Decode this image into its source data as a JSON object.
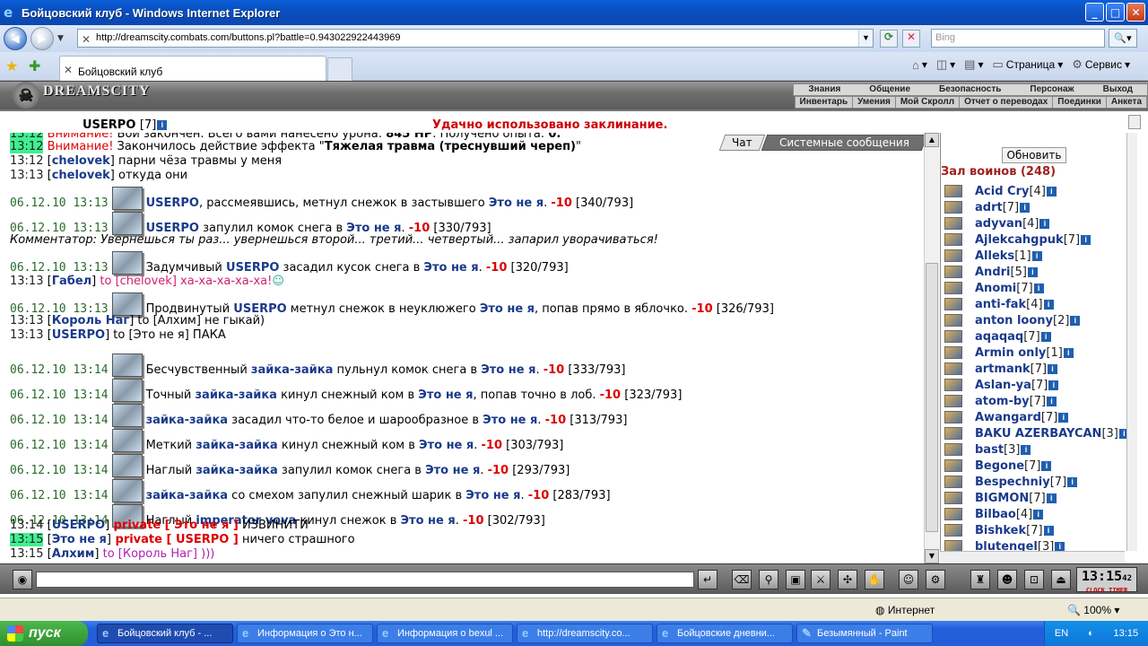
{
  "window": {
    "title": "Бойцовский клуб - Windows Internet Explorer"
  },
  "browser": {
    "url": "http://dreamscity.combats.com/buttons.pl?battle=0.943022922443969",
    "search_placeholder": "Bing",
    "tab_title": "Бойцовский клуб",
    "cmd_page": "Страница",
    "cmd_service": "Сервис"
  },
  "game": {
    "logo": "DREAMSCITY",
    "menu_top": [
      "Знания",
      "Общение",
      "Безопасность",
      "Персонаж",
      "Выход"
    ],
    "menu_bottom": [
      "Инвентарь",
      "Умения",
      "Мой Скролл",
      "Отчет о переводах",
      "Поединки",
      "Анкета"
    ],
    "player_name": "USERPO",
    "player_level": "[7]",
    "status_message": "Удачно использовано заклинание.",
    "chat_tab": "Чат",
    "system_tab": "Системные сообщения",
    "refresh_label": "Обновить",
    "hall_title": "Зал воинов (248)"
  },
  "chat": {
    "line0": {
      "time": "13:12",
      "a": "Внимание!",
      "b": " Бой закончен. Всего вами нанесено урона: ",
      "c": "845 HP",
      "d": ". Получено опыта: ",
      "e": "0."
    },
    "line1": {
      "time": "13:12",
      "a": "Внимание!",
      "b": " Закончилось действие эффекта \"",
      "c": "Тяжелая травма (треснувший череп)",
      "d": "\""
    },
    "line2": {
      "time": "13:12",
      "nick": "chelovek",
      "text": " парни чёза травмы у меня"
    },
    "line3": {
      "time": "13:13",
      "nick": "chelovek",
      "text": " откуда они"
    },
    "line4": {
      "ts": "06.12.10 13:13",
      "who": "USERPO",
      "mid": ", рассмеявшись, метнул снежок в застывшего ",
      "target": "Это не я",
      "dmg": "-10",
      "hp": " [340/793]"
    },
    "line5": {
      "ts": "06.12.10 13:13",
      "who": "USERPO",
      "mid": " запулил комок снега в ",
      "target": "Это не я",
      "dmg": "-10",
      "hp": " [330/793]"
    },
    "line6": {
      "text": "Комментатор: Увернешься ты раз... увернешься второй... третий... четвертый... запарил уворачиваться!"
    },
    "line7": {
      "ts": "06.12.10 13:13",
      "pre": "Задумчивый ",
      "who": "USERPO",
      "mid": " засадил кусок снега в ",
      "target": "Это не я",
      "dmg": "-10",
      "hp": " [320/793]"
    },
    "line8": {
      "time": "13:13",
      "nick": "Габел",
      "to": " to ",
      "dest": "[chelovek]",
      "text": " ха-ха-ха-ха-ха!"
    },
    "line9": {
      "ts": "06.12.10 13:13",
      "pre": "Продвинутый ",
      "who": "USERPO",
      "mid": " метнул снежок в неуклюжего ",
      "target": "Это не я",
      "mid2": ", попав прямо в яблочко. ",
      "dmg": "-10",
      "hp": " [326/793]"
    },
    "line10": {
      "time": "13:13",
      "nick": "Король Наг",
      "rest": " to [Алхим] не гыкай)"
    },
    "line11": {
      "time": "13:13",
      "nick": "USERPO",
      "rest": " to [Это не я] ПАКА"
    },
    "line12": {
      "ts": "06.12.10 13:14",
      "pre": "Бесчувственный ",
      "who": "зайка-зайка",
      "mid": " пульнул комок снега в ",
      "target": "Это не я",
      "dmg": "-10",
      "hp": " [333/793]"
    },
    "line13": {
      "ts": "06.12.10 13:14",
      "pre": "Точный ",
      "who": "зайка-зайка",
      "mid": " кинул снежный ком в ",
      "target": "Это не я",
      "mid2": ", попав точно в лоб. ",
      "dmg": "-10",
      "hp": " [323/793]"
    },
    "line14": {
      "ts": "06.12.10 13:14",
      "who": "зайка-зайка",
      "mid": " засадил что-то белое и шарообразное в ",
      "target": "Это не я",
      "dmg": "-10",
      "hp": " [313/793]"
    },
    "line15": {
      "ts": "06.12.10 13:14",
      "pre": "Меткий ",
      "who": "зайка-зайка",
      "mid": " кинул снежный ком в ",
      "target": "Это не я",
      "dmg": "-10",
      "hp": " [303/793]"
    },
    "line16": {
      "ts": "06.12.10 13:14",
      "pre": "Наглый ",
      "who": "зайка-зайка",
      "mid": " запулил комок снега в ",
      "target": "Это не я",
      "dmg": "-10",
      "hp": " [293/793]"
    },
    "line17": {
      "ts": "06.12.10 13:14",
      "who": "зайка-зайка",
      "mid": " со смехом запулил снежный шарик в ",
      "target": "Это не я",
      "dmg": "-10",
      "hp": " [283/793]"
    },
    "line18": {
      "ts": "06.12.10 13:14",
      "pre": "Наглый ",
      "who": "imperator vova",
      "mid": " кинул снежок в ",
      "target": "Это не я",
      "dmg": "-10",
      "hp": " [302/793]"
    },
    "line19": {
      "time": "13:14",
      "nick": "USERPO",
      "pv": " private [ Это не я ]",
      "text": " ИЗВИНИТИ"
    },
    "line20": {
      "time": "13:15",
      "nick": "Это не я",
      "pv": " private [ USERPO ]",
      "text": " ничего страшного"
    },
    "line21": {
      "time": "13:15",
      "nick": "Алхим",
      "rest": " to [Король Наг] )))"
    }
  },
  "users": [
    {
      "name": "Acid Cry",
      "lvl": "[4]"
    },
    {
      "name": "adrt",
      "lvl": "[7]"
    },
    {
      "name": "adyvan",
      "lvl": "[4]"
    },
    {
      "name": "Ajlekcahgpuk",
      "lvl": "[7]"
    },
    {
      "name": "Alleks",
      "lvl": "[1]"
    },
    {
      "name": "Andri",
      "lvl": "[5]"
    },
    {
      "name": "Anomi",
      "lvl": "[7]"
    },
    {
      "name": "anti-fak",
      "lvl": "[4]"
    },
    {
      "name": "anton loony",
      "lvl": "[2]"
    },
    {
      "name": "aqaqaq",
      "lvl": "[7]"
    },
    {
      "name": "Armin only",
      "lvl": "[1]"
    },
    {
      "name": "artmank",
      "lvl": "[7]"
    },
    {
      "name": "Aslan-ya",
      "lvl": "[7]"
    },
    {
      "name": "atom-by",
      "lvl": "[7]"
    },
    {
      "name": "Awangard",
      "lvl": "[7]"
    },
    {
      "name": "BAKU AZERBAYCAN",
      "lvl": "[3]"
    },
    {
      "name": "bast",
      "lvl": "[3]"
    },
    {
      "name": "Begone",
      "lvl": "[7]"
    },
    {
      "name": "Bespechniy",
      "lvl": "[7]"
    },
    {
      "name": "BIGMON",
      "lvl": "[7]"
    },
    {
      "name": "Bilbao",
      "lvl": "[4]"
    },
    {
      "name": "Bishkek",
      "lvl": "[7]"
    },
    {
      "name": "blutengel",
      "lvl": "[3]"
    }
  ],
  "clock": {
    "time": "13:15",
    "sec": "42",
    "label1": "CLOCK",
    "label2": "TIMER"
  },
  "status": {
    "zone": "Интернет",
    "zoom": "100%"
  },
  "taskbar": {
    "start": "пуск",
    "tasks": [
      "Бойцовский клуб - ...",
      "Информация о Это н...",
      "Информация о bexul ...",
      "http://dreamscity.co...",
      "Бойцовские дневни...",
      "Безымянный - Paint"
    ],
    "lang": "EN",
    "time": "13:15"
  }
}
